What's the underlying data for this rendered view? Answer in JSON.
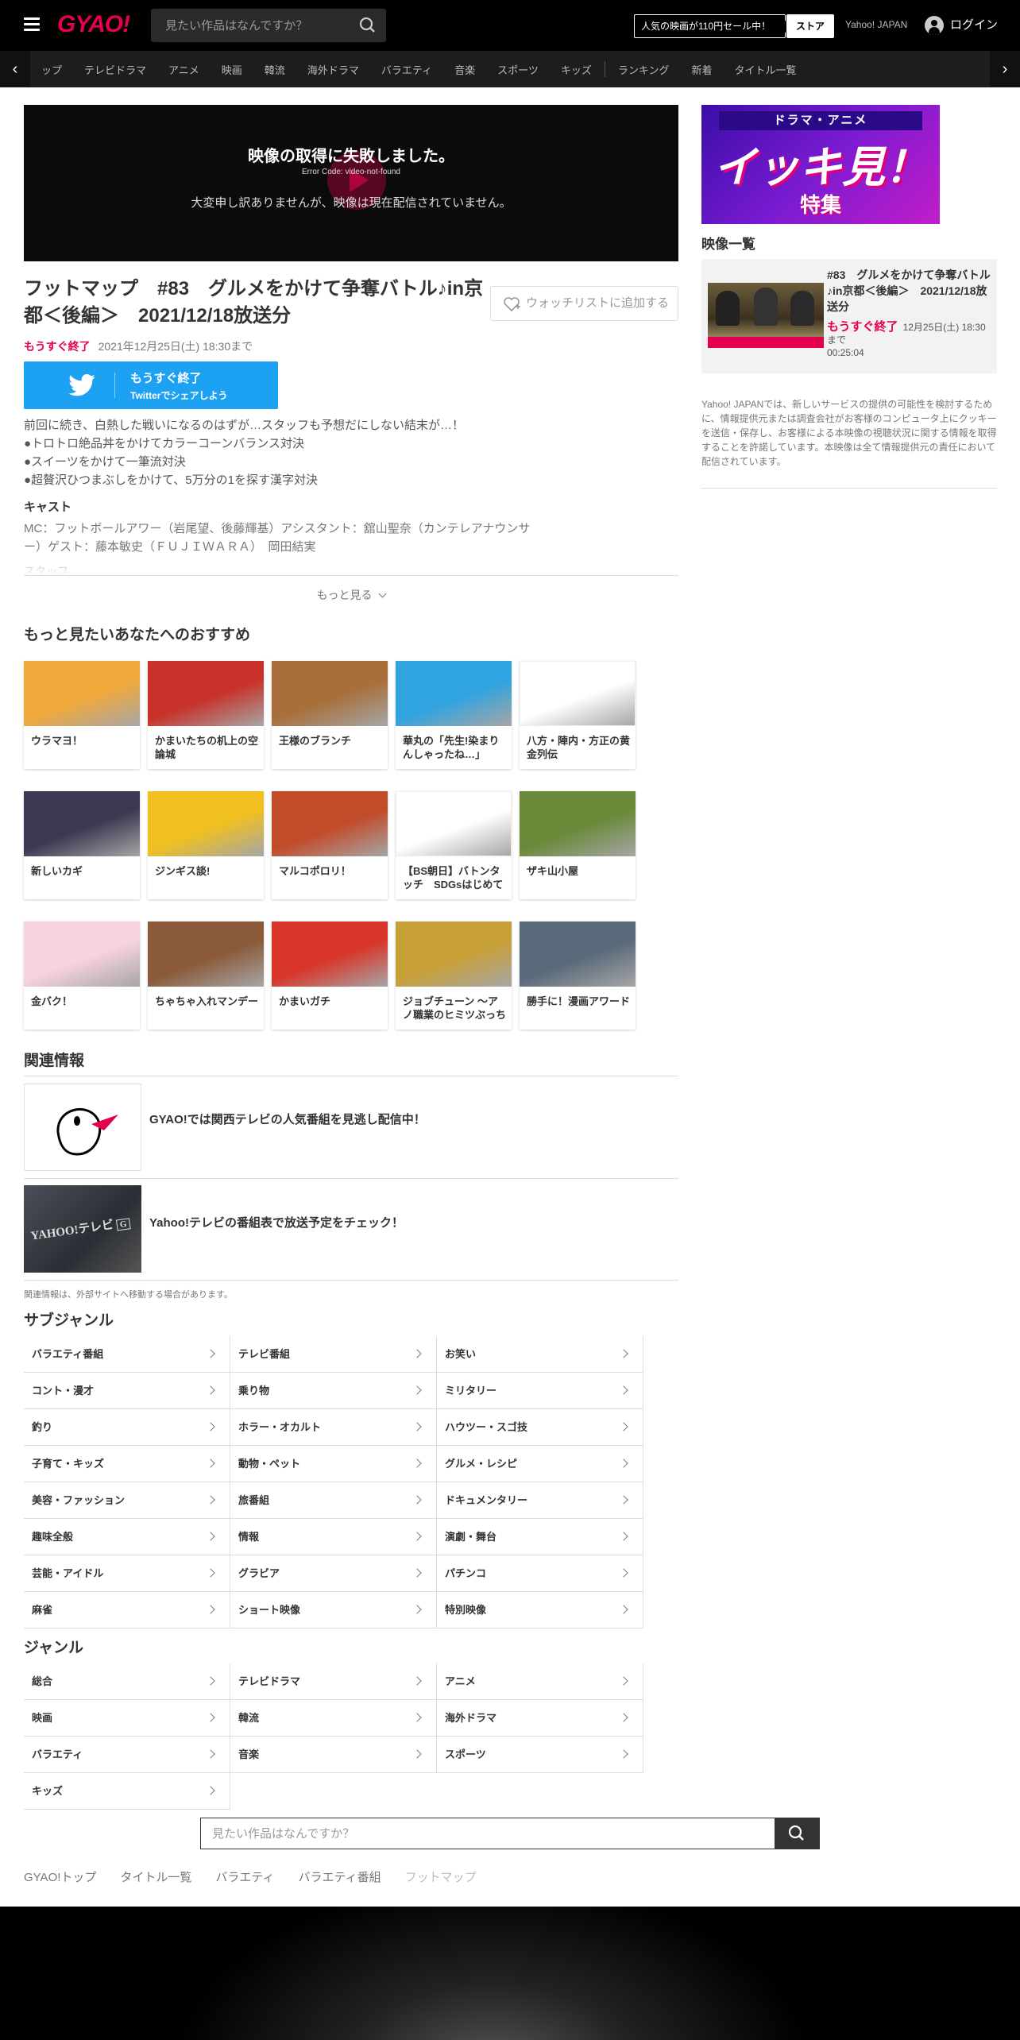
{
  "header": {
    "logo": "GYAO!",
    "search_placeholder": "見たい作品はなんですか？",
    "promo": "人気の映画が110円セール中！",
    "store": "ストア",
    "yahoo": "Yahoo! JAPAN",
    "login": "ログイン"
  },
  "nav": {
    "items": [
      "ップ",
      "テレビドラマ",
      "アニメ",
      "映画",
      "韓流",
      "海外ドラマ",
      "バラエティ",
      "音楽",
      "スポーツ",
      "キッズ"
    ],
    "items2": [
      "ランキング",
      "新着",
      "タイトル一覧"
    ]
  },
  "player": {
    "error_title": "映像の取得に失敗しました。",
    "error_code": "Error Code: video-not-found",
    "error_message": "大変申し訳ありませんが、映像は現在配信されていません。"
  },
  "program": {
    "title": "フットマップ　#83　グルメをかけて争奪バトル♪in京都＜後編＞　2021/12/18放送分",
    "watchlist": "ウォッチリストに追加する",
    "status_badge": "もうすぐ終了",
    "status_date": "2021年12月25日(土) 18:30まで",
    "twitter_line1": "もうすぐ終了",
    "twitter_line2": "Twitterでシェアしよう",
    "description": [
      "前回に続き、白熱した戦いになるのはずが…スタッフも予想だにしない結末が…！",
      "●トロトロ絶品丼をかけてカラーコーンバランス対決",
      "●スイーツをかけて一筆流対決",
      "●超贅沢ひつまぶしをかけて、5万分の1を探す漢字対決"
    ],
    "cast_heading": "キャスト",
    "cast_text": "MC：フットボールアワー（岩尾望、後藤輝基）アシスタント：舘山聖奈（カンテレアナウンサー）ゲスト：藤本敏史（ＦＵＪＩＷＡＲＡ）　岡田結実",
    "staff_heading": "スタッフ",
    "more": "もっと見る"
  },
  "recommend": {
    "heading": "もっと見たいあなたへのおすすめ",
    "items": [
      "ウラマヨ！",
      "かまいたちの机上の空論城",
      "王様のブランチ",
      "華丸の「先生!染まりんしゃったね…」",
      "八方・陣内・方正の黄金列伝",
      "新しいカギ",
      "ジンギス談!",
      "マルコポロリ！",
      "【BS朝日】バトンタッチ　SDGsはじめて",
      "ザキ山小屋",
      "金バク！",
      "ちゃちゃ入れマンデー",
      "かまいガチ",
      "ジョブチューン ～アノ職業のヒミツぶっちゃけます！",
      "勝手に！漫画アワード"
    ],
    "thumb_colors": [
      "#f2a93b",
      "#c8322a",
      "#a86f3b",
      "#2fa4e0",
      "#ffffff",
      "#3b3a52",
      "#f0c020",
      "#c24b2a",
      "#ffffff",
      "#6a8a3a",
      "#f7d2e0",
      "#8a5a3a",
      "#d8362a",
      "#c8a038",
      "#5a6a7a"
    ]
  },
  "related": {
    "heading": "関連情報",
    "items": [
      "GYAO!では関西テレビの人気番組を見逃し配信中！",
      "Yahoo!テレビの番組表で放送予定をチェック！"
    ],
    "note": "関連情報は、外部サイトへ移動する場合があります。"
  },
  "subgenre": {
    "heading": "サブジャンル",
    "items": [
      "バラエティ番組",
      "テレビ番組",
      "お笑い",
      "コント・漫才",
      "乗り物",
      "ミリタリー",
      "釣り",
      "ホラー・オカルト",
      "ハウツー・スゴ技",
      "子育て・キッズ",
      "動物・ペット",
      "グルメ・レシピ",
      "美容・ファッション",
      "旅番組",
      "ドキュメンタリー",
      "趣味全般",
      "情報",
      "演劇・舞台",
      "芸能・アイドル",
      "グラビア",
      "パチンコ",
      "麻雀",
      "ショート映像",
      "特別映像"
    ]
  },
  "genre": {
    "heading": "ジャンル",
    "items": [
      "総合",
      "テレビドラマ",
      "アニメ",
      "映画",
      "韓流",
      "海外ドラマ",
      "バラエティ",
      "音楽",
      "スポーツ",
      "キッズ"
    ]
  },
  "bottom": {
    "search_placeholder": "見たい作品はなんですか？",
    "breadcrumb": [
      "GYAO!トップ",
      "タイトル一覧",
      "バラエティ",
      "バラエティ番組",
      "フットマップ"
    ]
  },
  "sidebar": {
    "banner_top": "ドラマ・アニメ",
    "banner_big": "イッキ見！",
    "banner_small": "特集",
    "list_heading": "映像一覧",
    "video_title": "#83　グルメをかけて争奪バトル♪in京都＜後編＞　2021/12/18放送分",
    "video_badge": "もうすぐ終了",
    "video_date": "12月25日(土) 18:30まで",
    "video_duration": "00:25:04",
    "note": "Yahoo! JAPANでは、新しいサービスの提供の可能性を検討するために、情報提供元または調査会社がお客様のコンピュータ上にクッキーを送信・保存し、お客様による本映像の視聴状況に関する情報を取得することを許諾しています。本映像は全て情報提供元の責任において配信されています。"
  }
}
